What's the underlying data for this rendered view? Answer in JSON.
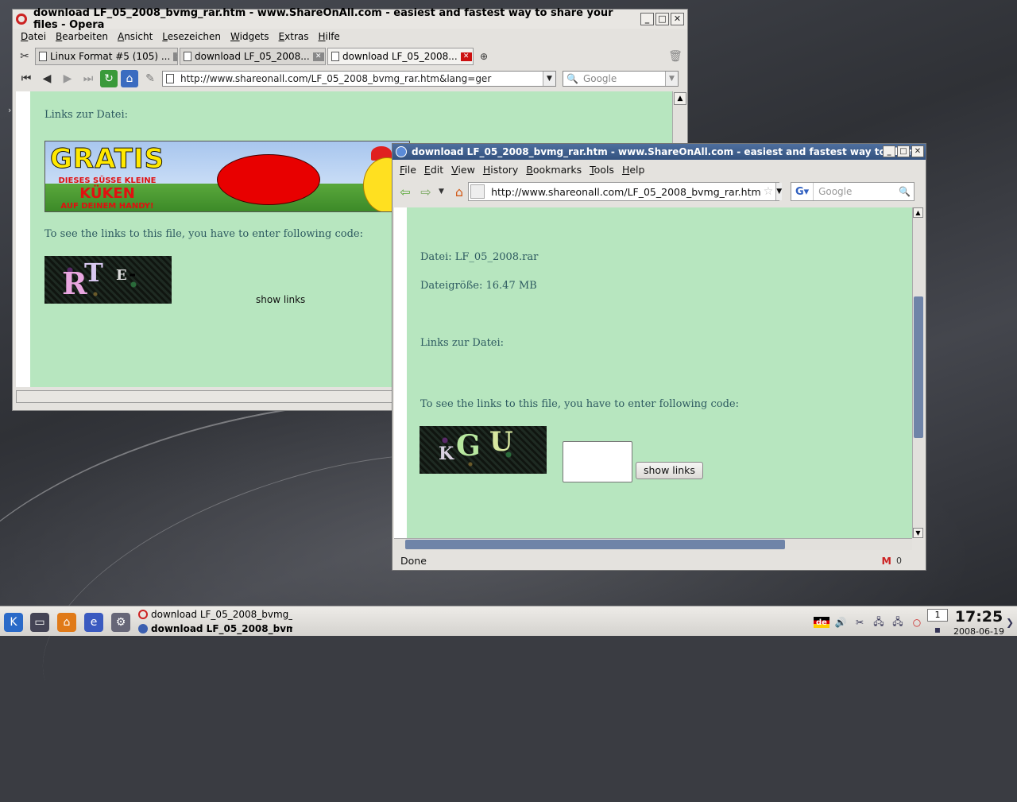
{
  "opera": {
    "title": "download LF_05_2008_bvmg_rar.htm - www.ShareOnAll.com - easiest and fastest way to share your files - Opera",
    "menu": [
      "Datei",
      "Bearbeiten",
      "Ansicht",
      "Lesezeichen",
      "Widgets",
      "Extras",
      "Hilfe"
    ],
    "tabs": [
      {
        "label": "Linux Format #5 (105) ..."
      },
      {
        "label": "download LF_05_2008..."
      },
      {
        "label": "download LF_05_2008..."
      }
    ],
    "url": "http://www.shareonall.com/LF_05_2008_bvmg_rar.htm&lang=ger",
    "search_placeholder": "Google",
    "content": {
      "links_label": "Links zur Datei:",
      "banner": {
        "headline": "GRATIS",
        "line1": "DIESES SÜSSE KLEINE",
        "line2": "KÜKEN",
        "line3": "AUF DEINEM HANDY!"
      },
      "instruction": "To see the links to this file, you have to enter following code:",
      "captcha_text": [
        "R",
        "T",
        "E",
        "-"
      ],
      "show_links": "show links"
    }
  },
  "firefox": {
    "title": "download LF_05_2008_bvmg_rar.htm - www.ShareOnAll.com - easiest and fastest way to shar",
    "menu": [
      "File",
      "Edit",
      "View",
      "History",
      "Bookmarks",
      "Tools",
      "Help"
    ],
    "url": "http://www.shareonall.com/LF_05_2008_bvmg_rar.htm",
    "search_placeholder": "Google",
    "content": {
      "file_name": "Datei: LF_05_2008.rar",
      "file_size": "Dateigröße: 16.47 MB",
      "links_label": "Links zur Datei:",
      "instruction": "To see the links to this file, you have to enter following code:",
      "captcha_text": [
        "K",
        "G",
        "U"
      ],
      "code_value": "",
      "show_links": "show links"
    },
    "status": "Done",
    "mail_count": "0"
  },
  "taskbar": {
    "tasks": [
      {
        "label": "download LF_05_2008_bvmg_r",
        "active": false
      },
      {
        "label": "download LF_05_2008_bvm",
        "active": true
      }
    ],
    "keyboard_layout": "de",
    "desktop_number": "1",
    "time": "17:25",
    "date": "2008-06-19"
  },
  "colors": {
    "page_bg": "#b7e6bf",
    "page_text": "#2d5a60",
    "ff_titlebar": "#3d5e8f"
  }
}
